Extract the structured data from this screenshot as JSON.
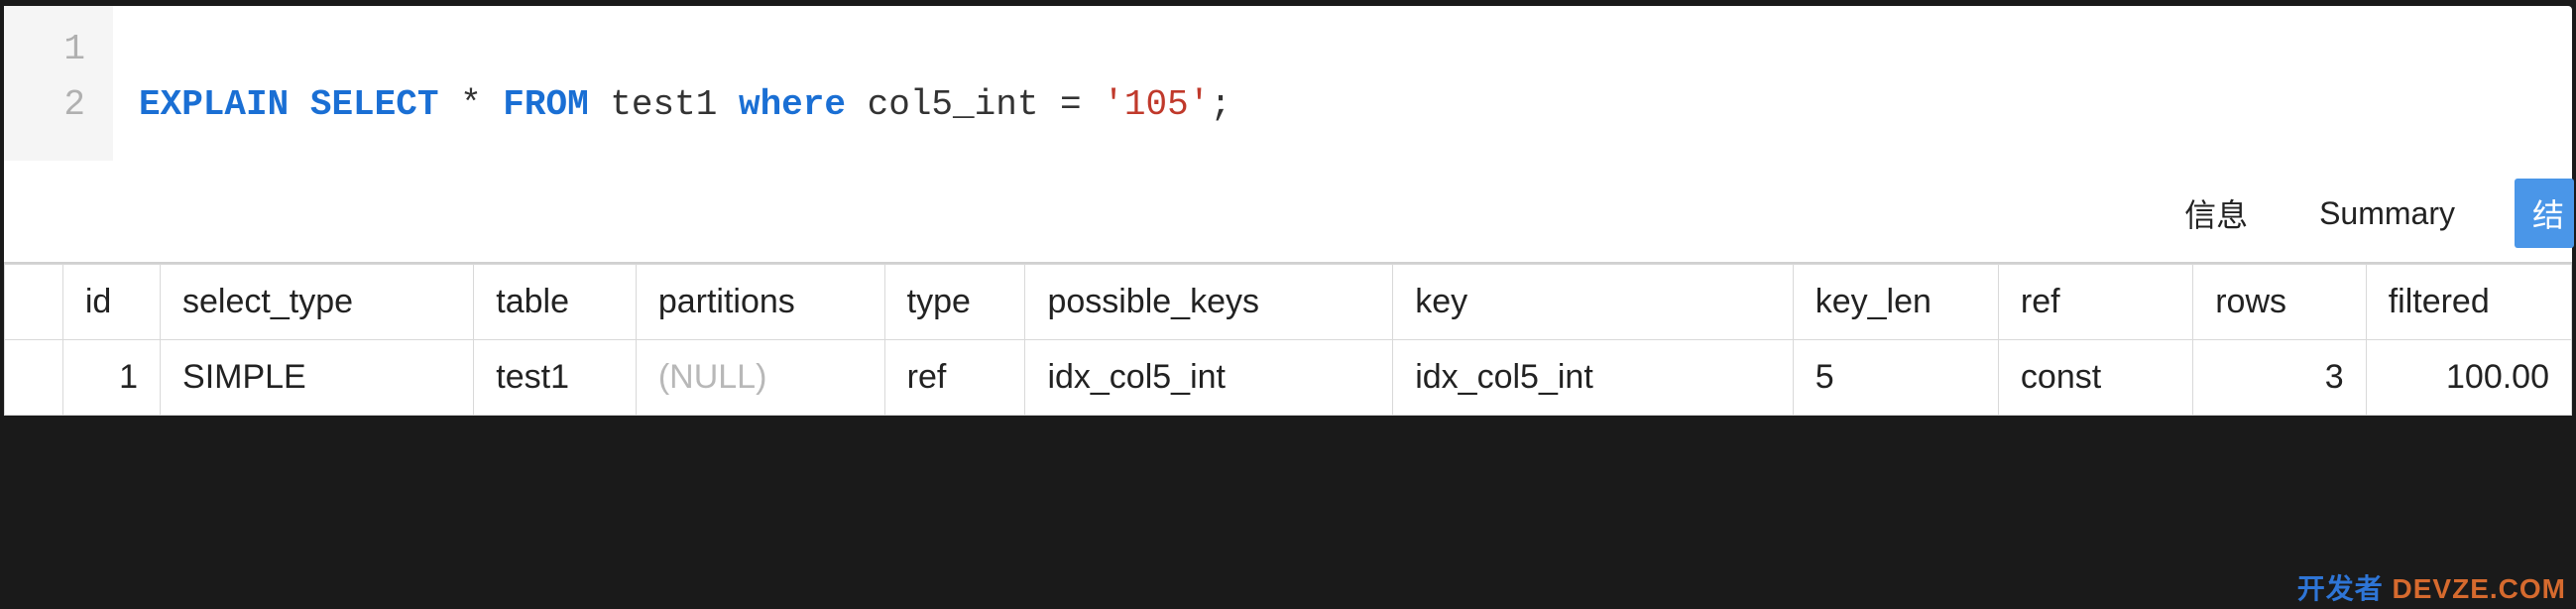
{
  "editor": {
    "lines": [
      {
        "num": "1",
        "tokens": []
      },
      {
        "num": "2",
        "tokens": [
          {
            "cls": "kw",
            "t": "EXPLAIN"
          },
          {
            "cls": "sp",
            "t": " "
          },
          {
            "cls": "kw",
            "t": "SELECT"
          },
          {
            "cls": "sp",
            "t": " "
          },
          {
            "cls": "op",
            "t": "*"
          },
          {
            "cls": "sp",
            "t": " "
          },
          {
            "cls": "kw",
            "t": "FROM"
          },
          {
            "cls": "sp",
            "t": " "
          },
          {
            "cls": "ident",
            "t": "test1"
          },
          {
            "cls": "sp",
            "t": " "
          },
          {
            "cls": "kw",
            "t": "where"
          },
          {
            "cls": "sp",
            "t": " "
          },
          {
            "cls": "ident",
            "t": "col5_int"
          },
          {
            "cls": "sp",
            "t": " "
          },
          {
            "cls": "op",
            "t": "="
          },
          {
            "cls": "sp",
            "t": " "
          },
          {
            "cls": "str",
            "t": "'105'"
          },
          {
            "cls": "punct",
            "t": ";"
          }
        ]
      }
    ]
  },
  "tabs": {
    "info": "信息",
    "summary": "Summary",
    "result": "结"
  },
  "table": {
    "headers": {
      "id": "id",
      "select_type": "select_type",
      "table": "table",
      "partitions": "partitions",
      "type": "type",
      "possible_keys": "possible_keys",
      "key": "key",
      "key_len": "key_len",
      "ref": "ref",
      "rows": "rows",
      "filtered": "filtered"
    },
    "rows": [
      {
        "id": "1",
        "select_type": "SIMPLE",
        "table": "test1",
        "partitions": "(NULL)",
        "type": "ref",
        "possible_keys": "idx_col5_int",
        "key": "idx_col5_int",
        "key_len": "5",
        "ref": "const",
        "rows": "3",
        "filtered": "100.00"
      }
    ]
  },
  "watermark": {
    "part1": "开发者",
    "part2": "DEVZE.COM"
  }
}
